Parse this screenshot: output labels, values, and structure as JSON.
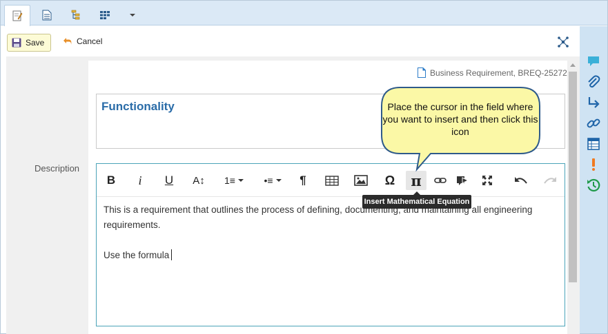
{
  "tabs": [
    {
      "icon": "edit-page-icon",
      "active": true
    },
    {
      "icon": "document-icon",
      "active": false
    },
    {
      "icon": "tree-icon",
      "active": false
    },
    {
      "icon": "grid-icon",
      "active": false
    },
    {
      "icon": "chevron-down-icon",
      "active": false
    }
  ],
  "actions": {
    "save_label": "Save",
    "cancel_label": "Cancel"
  },
  "requirement": {
    "id_label": "Business Requirement, BREQ-25272",
    "title": "Functionality"
  },
  "description": {
    "label": "Description",
    "paragraph1": "This is a requirement that outlines the process of defining, documenting, and maintaining all engineering requirements.",
    "paragraph2": "Use the formula"
  },
  "editor_toolbar": [
    {
      "name": "bold",
      "glyph": "B"
    },
    {
      "name": "italic",
      "glyph": "i"
    },
    {
      "name": "underline",
      "glyph": "U"
    },
    {
      "name": "font-size",
      "glyph": "A↕"
    },
    {
      "name": "ordered-list",
      "glyph": "1≡"
    },
    {
      "name": "unordered-list",
      "glyph": "•≡"
    },
    {
      "name": "paragraph",
      "glyph": "¶"
    },
    {
      "name": "table",
      "glyph": "⊞"
    },
    {
      "name": "image",
      "glyph": "▣"
    },
    {
      "name": "special-character",
      "glyph": "Ω"
    },
    {
      "name": "math-equation",
      "glyph": "π"
    },
    {
      "name": "link",
      "glyph": "∞"
    },
    {
      "name": "embed",
      "glyph": "▶"
    },
    {
      "name": "fullscreen",
      "glyph": "⤢"
    },
    {
      "name": "undo",
      "glyph": "↶"
    },
    {
      "name": "redo",
      "glyph": "↷"
    }
  ],
  "tooltip": "Insert Mathematical Equation",
  "callout": "Place the cursor in the field where you want to insert and then click this icon",
  "right_sidebar": [
    "comment-icon",
    "attachment-icon",
    "trace-arrow-icon",
    "link-icon",
    "table-icon",
    "alert-icon",
    "history-icon"
  ],
  "colors": {
    "accent": "#2a6ca8",
    "editor_border": "#4aa3b8",
    "tab_strip": "#dbe9f6",
    "sidebar": "#cfe3f3",
    "save_bg": "#fdfbd6",
    "callout_bg": "#fbf8a6",
    "callout_border": "#2e5a8a"
  }
}
